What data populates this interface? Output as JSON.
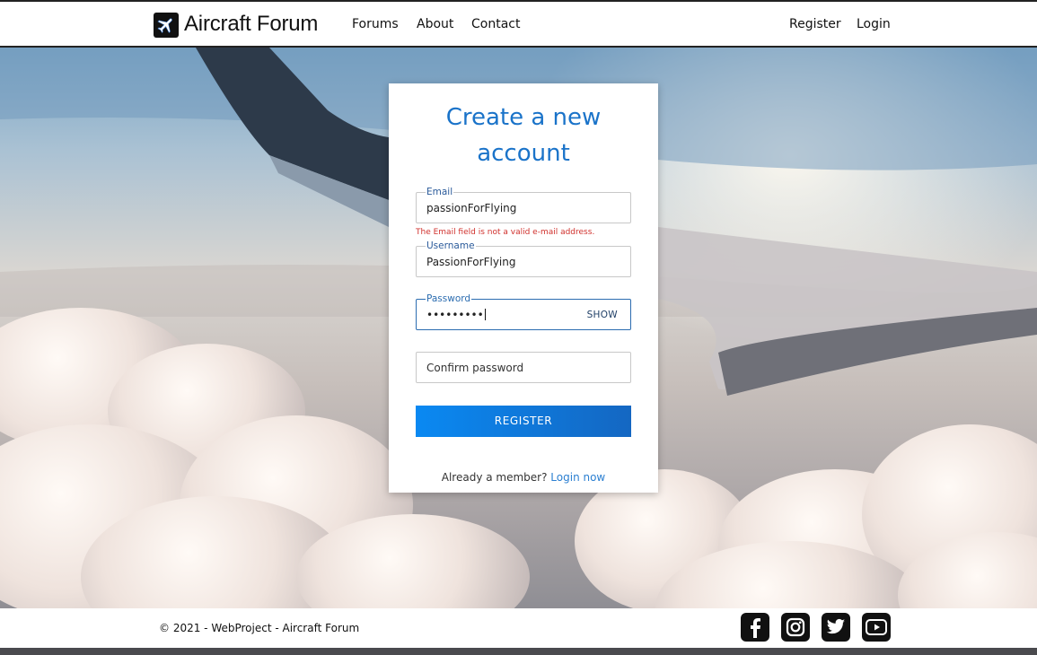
{
  "header": {
    "brand": "Aircraft Forum",
    "nav": [
      "Forums",
      "About",
      "Contact"
    ],
    "register": "Register",
    "login": "Login"
  },
  "form": {
    "title_line1": "Create a new",
    "title_line2": "account",
    "email_label": "Email",
    "email_value": "passionForFlying",
    "email_error": "The Email field is not a valid e-mail address.",
    "username_label": "Username",
    "username_value": "PassionForFlying",
    "password_label": "Password",
    "password_value": "•••••••••",
    "show_label": "SHOW",
    "confirm_placeholder": "Confirm password",
    "register_button": "REGISTER",
    "member_text": "Already a member?",
    "login_link": "Login now"
  },
  "footer": {
    "copyright": "© 2021 - WebProject - Aircraft Forum",
    "social": [
      "facebook-icon",
      "instagram-icon",
      "twitter-icon",
      "youtube-icon"
    ]
  },
  "colors": {
    "accent": "#1a73c9",
    "error": "#d0312d",
    "button_start": "#0a89f2",
    "button_end": "#1467c2"
  }
}
